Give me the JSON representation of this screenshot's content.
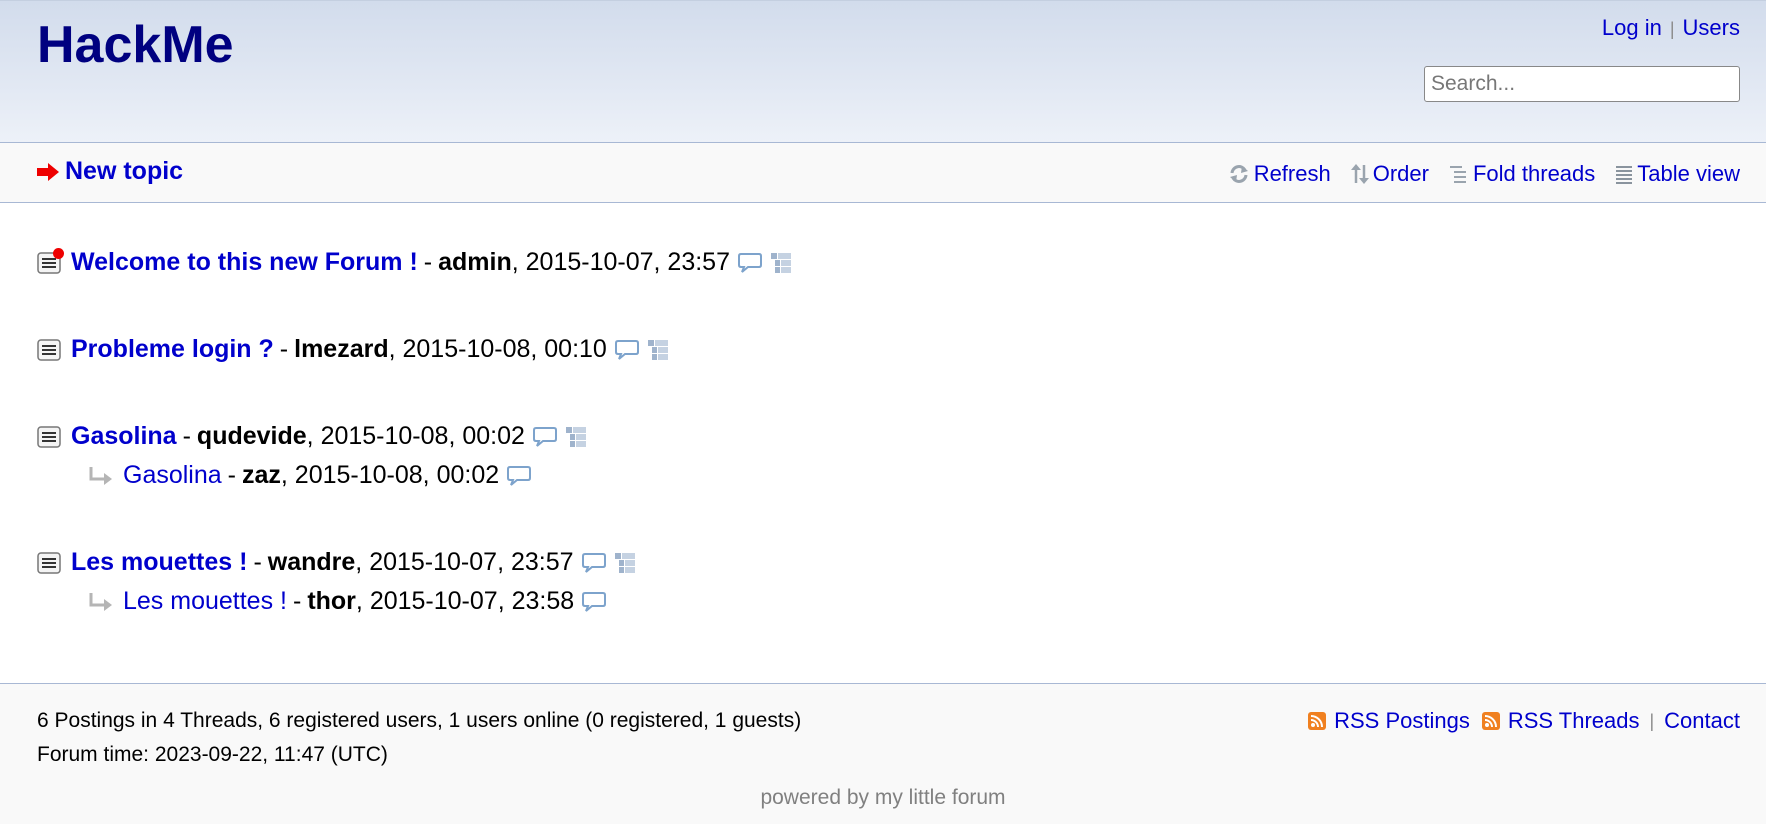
{
  "header": {
    "logo": "HackMe",
    "login_label": "Log in",
    "users_label": "Users",
    "search_placeholder": "Search..."
  },
  "subnav": {
    "new_topic_label": "New topic",
    "refresh_label": "Refresh",
    "order_label": "Order",
    "fold_label": "Fold threads",
    "table_label": "Table view"
  },
  "threads": [
    {
      "title": "Welcome to this new Forum !",
      "author": "admin",
      "datetime": ", 2015-10-07, 23:57",
      "new": true,
      "replies": []
    },
    {
      "title": "Probleme login ?",
      "author": "lmezard",
      "datetime": ", 2015-10-08, 00:10",
      "new": false,
      "replies": []
    },
    {
      "title": "Gasolina",
      "author": "qudevide",
      "datetime": ", 2015-10-08, 00:02",
      "new": false,
      "replies": [
        {
          "title": "Gasolina",
          "author": "zaz",
          "datetime": ", 2015-10-08, 00:02"
        }
      ]
    },
    {
      "title": "Les mouettes !",
      "author": "wandre",
      "datetime": ", 2015-10-07, 23:57",
      "new": false,
      "replies": [
        {
          "title": "Les mouettes !",
          "author": "thor",
          "datetime": ", 2015-10-07, 23:58"
        }
      ]
    }
  ],
  "separator": "-",
  "footer": {
    "stats": "6 Postings in 4 Threads, 6 registered users, 1 users online (0 registered, 1 guests)",
    "forum_time": "Forum time: 2023-09-22, 11:47 (UTC)",
    "rss_postings_label": "RSS Postings",
    "rss_threads_label": "RSS Threads",
    "contact_label": "Contact",
    "powered_prefix": "powered by ",
    "powered_link": "my little forum"
  },
  "colors": {
    "link": "#0000cc",
    "logo": "#000080",
    "new_indicator": "#ee0000",
    "rss": "#f08020"
  }
}
